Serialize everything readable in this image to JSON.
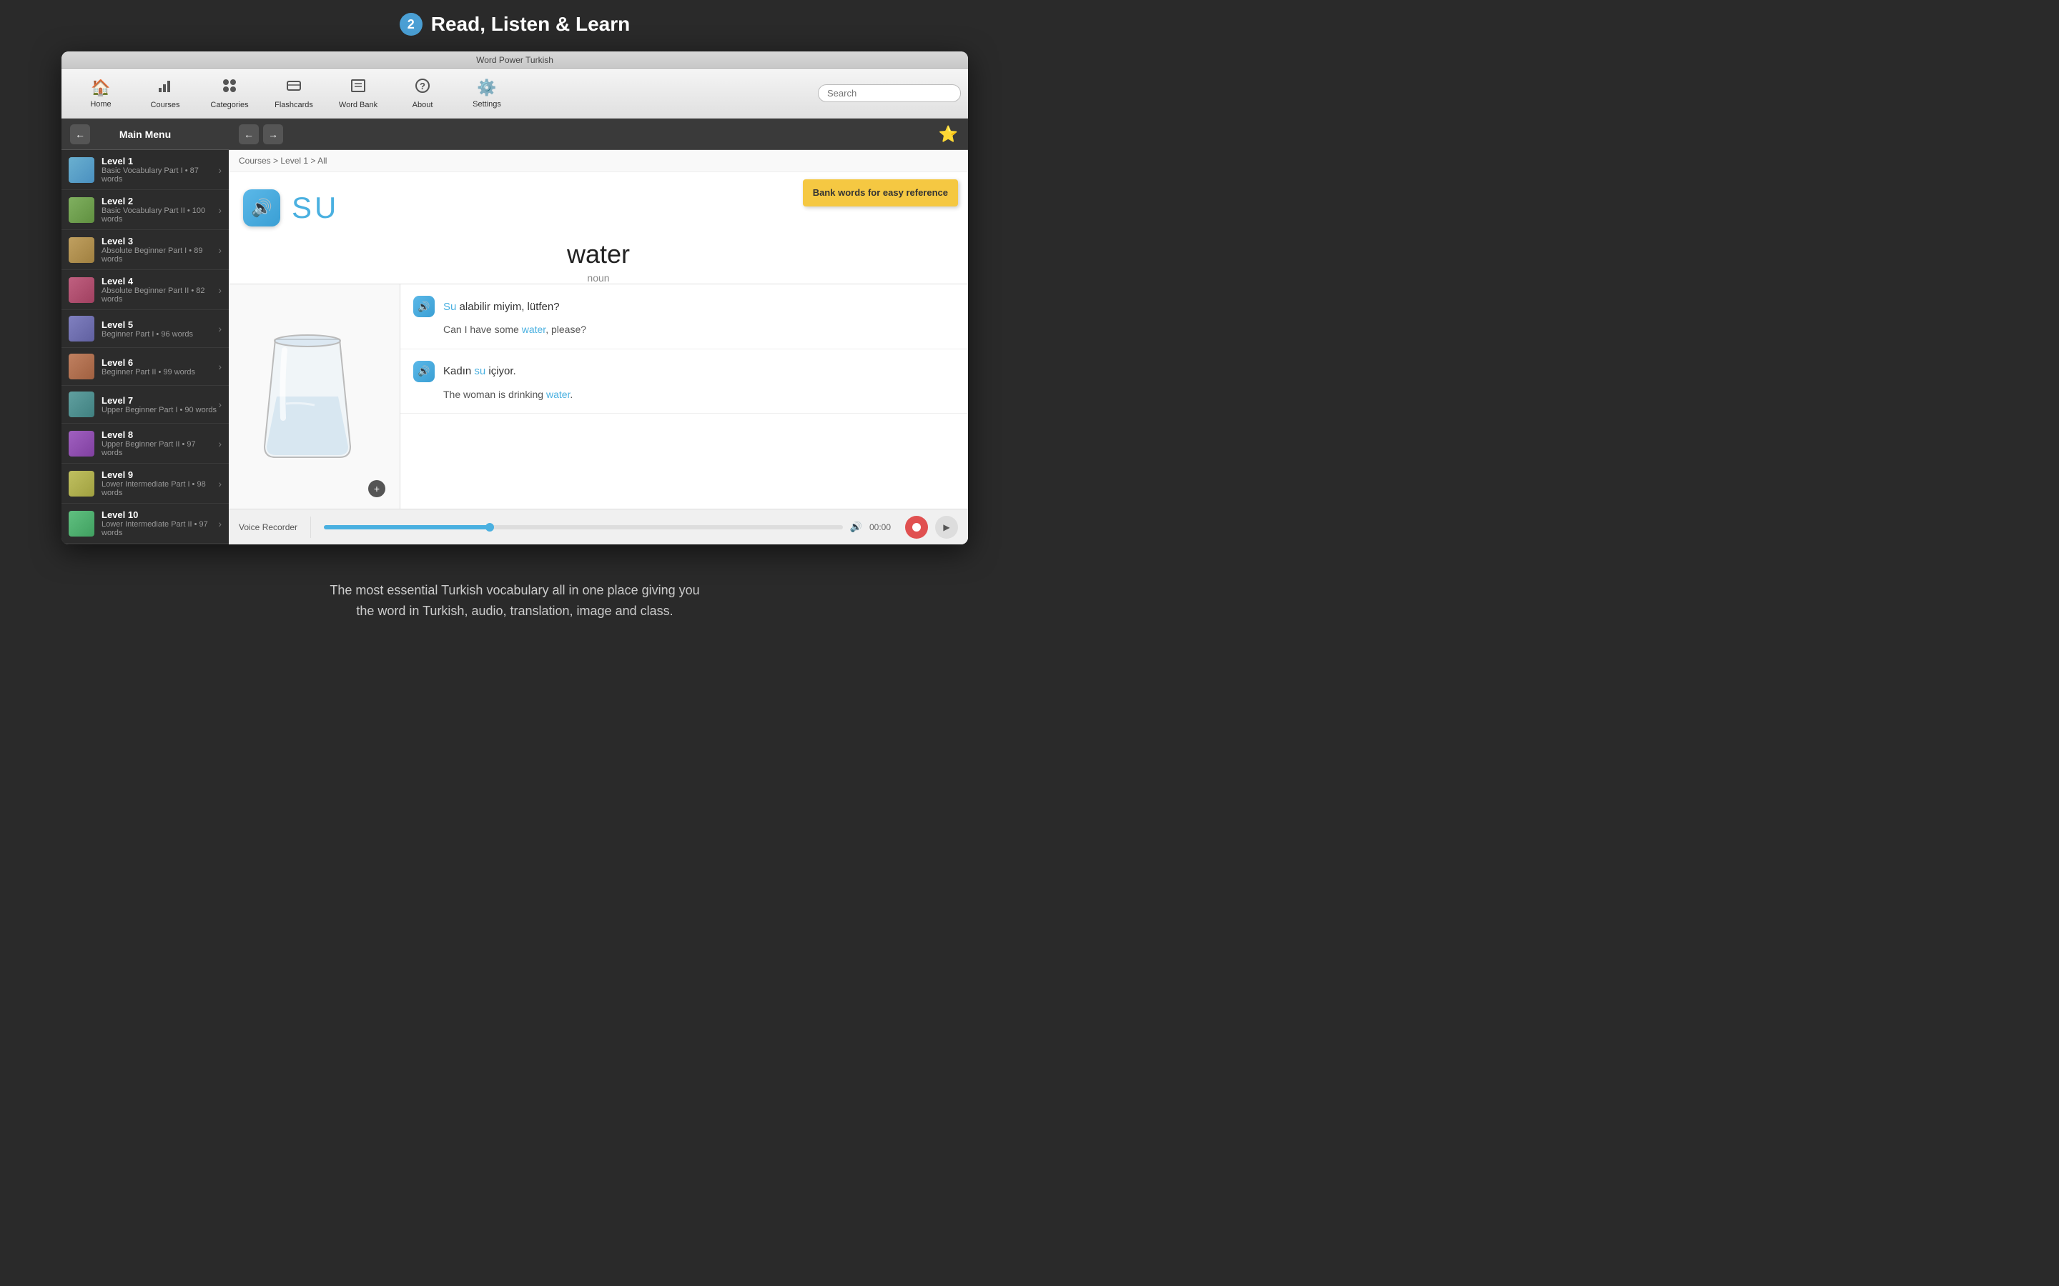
{
  "app": {
    "title": "Word Power Turkish",
    "step_badge": "2",
    "main_title": "Read, Listen & Learn"
  },
  "toolbar": {
    "items": [
      {
        "id": "home",
        "label": "Home",
        "icon": "🏠"
      },
      {
        "id": "courses",
        "label": "Courses",
        "icon": "📊"
      },
      {
        "id": "categories",
        "label": "Categories",
        "icon": "🏷"
      },
      {
        "id": "flashcards",
        "label": "Flashcards",
        "icon": "🗂"
      },
      {
        "id": "wordbank",
        "label": "Word Bank",
        "icon": "🗃"
      },
      {
        "id": "about",
        "label": "About",
        "icon": "❓"
      },
      {
        "id": "settings",
        "label": "Settings",
        "icon": "⚙️"
      }
    ],
    "search_placeholder": "Search"
  },
  "sidebar": {
    "title": "Main Menu",
    "items": [
      {
        "level": "Level 1",
        "sub": "Basic Vocabulary Part I • 87 words",
        "thumb_class": "thumb-level1"
      },
      {
        "level": "Level 2",
        "sub": "Basic Vocabulary Part II • 100 words",
        "thumb_class": "thumb-level2"
      },
      {
        "level": "Level 3",
        "sub": "Absolute Beginner Part I • 89 words",
        "thumb_class": "thumb-level3"
      },
      {
        "level": "Level 4",
        "sub": "Absolute Beginner Part II • 82 words",
        "thumb_class": "thumb-level4"
      },
      {
        "level": "Level 5",
        "sub": "Beginner Part I • 96 words",
        "thumb_class": "thumb-level5"
      },
      {
        "level": "Level 6",
        "sub": "Beginner Part II • 99 words",
        "thumb_class": "thumb-level6"
      },
      {
        "level": "Level 7",
        "sub": "Upper Beginner Part I • 90 words",
        "thumb_class": "thumb-level7"
      },
      {
        "level": "Level 8",
        "sub": "Upper Beginner Part II • 97 words",
        "thumb_class": "thumb-level8"
      },
      {
        "level": "Level 9",
        "sub": "Lower Intermediate Part I • 98 words",
        "thumb_class": "thumb-level9"
      },
      {
        "level": "Level 10",
        "sub": "Lower Intermediate Part II • 97 words",
        "thumb_class": "thumb-level10"
      }
    ]
  },
  "content": {
    "breadcrumb": "Courses > Level 1 > All",
    "word_turkish": "SU",
    "word_english": "water",
    "word_pos": "noun",
    "bank_tooltip": "Bank words for easy reference",
    "sentences": [
      {
        "turkish_parts": [
          "Su",
          " alabilir miyim, lütfen?"
        ],
        "turkish_highlight": "Su",
        "english_parts": [
          "Can I have some ",
          "water",
          ", please?"
        ],
        "english_highlight": "water"
      },
      {
        "turkish_parts": [
          "Kadın ",
          "su",
          " içiyor."
        ],
        "turkish_highlight": "su",
        "english_parts": [
          "The woman is drinking ",
          "water",
          "."
        ],
        "english_highlight": "water"
      }
    ]
  },
  "voice_recorder": {
    "label": "Voice Recorder",
    "time": "00:00"
  },
  "bottom_description": {
    "line1": "The most essential Turkish vocabulary all in one place giving you",
    "line2": "the word in Turkish, audio, translation, image and class."
  }
}
